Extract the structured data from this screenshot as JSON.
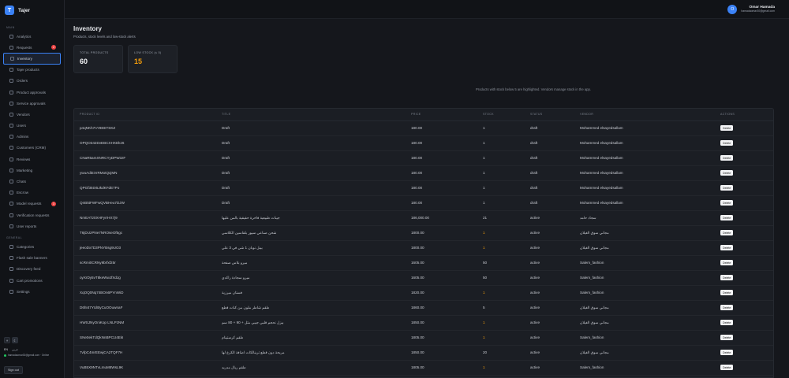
{
  "brand": {
    "logo_letter": "T",
    "name": "Tajer"
  },
  "sidebar": {
    "main_label": "MAIN",
    "general_label": "GENERAL",
    "items": [
      {
        "label": "Analytics",
        "icon": "chart-icon"
      },
      {
        "label": "Requests",
        "icon": "inbox-icon",
        "badge": "2"
      },
      {
        "label": "Inventory",
        "icon": "box-icon",
        "active": true
      },
      {
        "label": "Tajer products",
        "icon": "tag-icon"
      },
      {
        "label": "Orders",
        "icon": "cart-icon"
      },
      {
        "label": "Product approvals",
        "icon": "check-icon"
      },
      {
        "label": "Service approvals",
        "icon": "check-icon"
      },
      {
        "label": "Vendors",
        "icon": "store-icon"
      },
      {
        "label": "Users",
        "icon": "users-icon"
      },
      {
        "label": "Admins",
        "icon": "shield-icon"
      },
      {
        "label": "Customers (CRM)",
        "icon": "contacts-icon"
      },
      {
        "label": "Reviews",
        "icon": "star-icon"
      },
      {
        "label": "Marketing",
        "icon": "megaphone-icon"
      },
      {
        "label": "Chats",
        "icon": "chat-icon"
      },
      {
        "label": "Escrow",
        "icon": "wallet-icon"
      },
      {
        "label": "Model requests",
        "icon": "model-icon",
        "badge": "3"
      },
      {
        "label": "Verification requests",
        "icon": "verify-icon"
      },
      {
        "label": "User reports",
        "icon": "flag-icon"
      }
    ],
    "general_items": [
      {
        "label": "Categories",
        "icon": "grid-icon"
      },
      {
        "label": "Flash sale banners",
        "icon": "image-icon"
      },
      {
        "label": "Discovery feed",
        "icon": "compass-icon"
      },
      {
        "label": "Cart promotions",
        "icon": "gift-icon"
      },
      {
        "label": "Settings",
        "icon": "gear-icon"
      }
    ],
    "footer": {
      "lang_en": "EN",
      "lang_ar": "عربي",
      "account_text": "hamadaomar30@gmail.com · Online",
      "signout_label": "Sign out"
    }
  },
  "topbar": {
    "avatar_letter": "O",
    "user_name": "Omar Hamada",
    "user_email": "hamadaomar30@gmail.com"
  },
  "page": {
    "title": "Inventory",
    "subtitle": "Products, stock levels and low-stock alerts",
    "stats": [
      {
        "label": "TOTAL PRODUCTS",
        "value": "60"
      },
      {
        "label": "LOW STOCK (≤ 5)",
        "value": "15"
      }
    ],
    "hint": "Products with stock below 5 are highlighted. Vendors manage stock in the app."
  },
  "table": {
    "columns": [
      "PRODUCT ID",
      "TITLE",
      "PRICE",
      "STOCK",
      "STATUS",
      "VENDOR",
      "ACTIONS"
    ],
    "delete_label": "Delete",
    "rows": [
      {
        "id": "p4qNKh7nY8EETSKZ",
        "title": "Draft",
        "price": "180.00",
        "stock": "1",
        "status": "draft",
        "vendor": "Mohammed elsayedsallam",
        "low": false
      },
      {
        "id": "OPQO342DvEBCXHXDkz6",
        "title": "Draft",
        "price": "180.00",
        "stock": "1",
        "status": "draft",
        "vendor": "Mohammed elsayedsallam",
        "low": false
      },
      {
        "id": "CNaR5amXNRCYyDPW3zF",
        "title": "Draft",
        "price": "180.00",
        "stock": "1",
        "status": "draft",
        "vendor": "Mohammed elsayedsallam",
        "low": false
      },
      {
        "id": "ywuAdiEXrRMotQxjMN",
        "title": "Draft",
        "price": "180.00",
        "stock": "1",
        "status": "draft",
        "vendor": "Mohammed elsayedsallam",
        "low": false
      },
      {
        "id": "QPGf35tX5JkdKFdE7Po",
        "title": "Draft",
        "price": "180.00",
        "stock": "1",
        "status": "draft",
        "vendor": "Mohammed elsayedsallam",
        "low": false
      },
      {
        "id": "QnB5tFWFwQVBHeu7DJW",
        "title": "Draft",
        "price": "180.00",
        "stock": "1",
        "status": "draft",
        "vendor": "Mohammed elsayedsallam",
        "low": false
      },
      {
        "id": "NmEATz0XHFyrrHX7j9",
        "title": "جينات طبيعية فاخرة حقيقية بالمن عليها",
        "price": "186,000.00",
        "stock": "21",
        "status": "active",
        "vendor": "سجاد حامد",
        "low": false
      },
      {
        "id": "T6jDUzPNe7NROseOf5gc",
        "title": "شحن صناعي سيور بلقاسين الكلاسي",
        "price": "1800.00",
        "stock": "1",
        "status": "active",
        "vendor": "مجاني سوق الغيلان",
        "low": true
      },
      {
        "id": "jeeoDx7D3PNYBsg9UO3",
        "title": "بيبل نوبان 1 شي في 3 علي",
        "price": "1800.00",
        "stock": "1",
        "status": "active",
        "vendor": "مجاني سوق الغيلان",
        "low": true
      },
      {
        "id": "scRmi0CRNy9brfxf25r",
        "title": "ميرو بلاس صفحة",
        "price": "1605.00",
        "stock": "50",
        "status": "active",
        "vendor": "Salem_fashion",
        "low": false
      },
      {
        "id": "oyXrDy5vT8keWwJfXdJg",
        "title": "ميرو سجادة راكدي",
        "price": "1605.00",
        "stock": "50",
        "status": "active",
        "vendor": "Salem_fashion",
        "low": false
      },
      {
        "id": "XqOQ0Nq74BOn6PYnWiD",
        "title": "فستان ميرزية",
        "price": "1820.00",
        "stock": "1",
        "status": "active",
        "vendor": "Salem_fashion",
        "low": true
      },
      {
        "id": "D6hI47YUlByCuOOuwnaF",
        "title": "طقم شاطر ملون من كنات قطع",
        "price": "1860.00",
        "stock": "5",
        "status": "active",
        "vendor": "مجاني سوق الغيلان",
        "low": false
      },
      {
        "id": "HWSJNyOniKop LNLPzNM",
        "title": "بيزل نحجم قلبي جيبي مثل + 90 + 80 سم",
        "price": "1850.00",
        "stock": "1",
        "status": "active",
        "vendor": "مجاني سوق الغيلان",
        "low": true
      },
      {
        "id": "SNe0ekTdQkNnBPCU4EkI",
        "title": "طقم كرستينام",
        "price": "1805.00",
        "stock": "1",
        "status": "active",
        "vendor": "Salem_fashion",
        "low": true
      },
      {
        "id": "7vfpC4mrEEwjCA2TQF7H",
        "title": "مريحة دون قطع ترينالكات اضافة الكرع لها",
        "price": "1850.00",
        "stock": "20",
        "status": "active",
        "vendor": "مجاني سوق الغيلان",
        "low": false
      },
      {
        "id": "VuB5X9NTvLmuM8WsL9K",
        "title": "طقم ريال مدريد",
        "price": "1805.00",
        "stock": "1",
        "status": "active",
        "vendor": "Salem_fashion",
        "low": true
      }
    ]
  }
}
